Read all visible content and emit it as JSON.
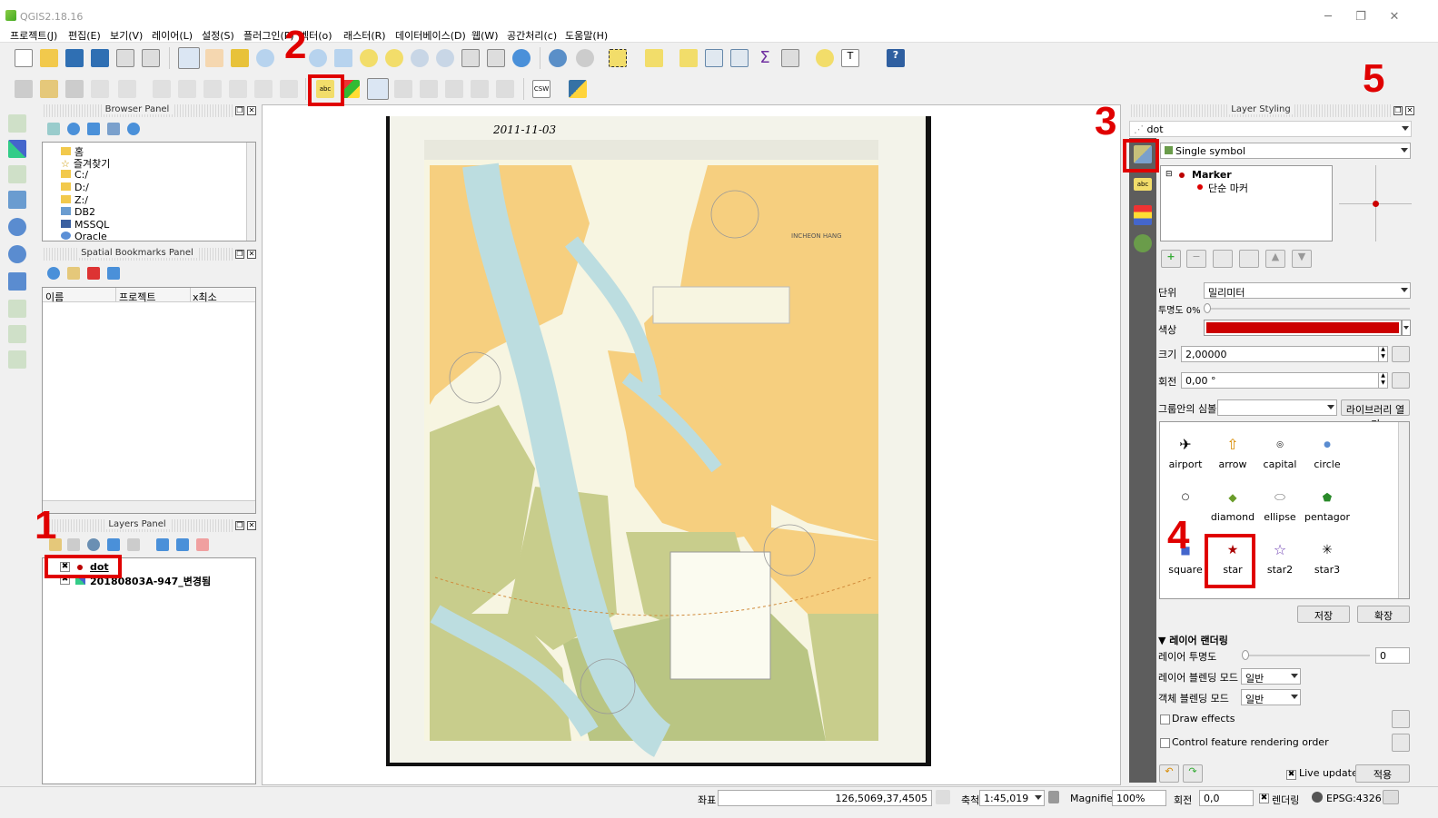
{
  "window": {
    "title": "QGIS2.18.16",
    "minimize": "─",
    "restore": "❐",
    "close": "✕"
  },
  "menu": [
    "프로젝트(J)",
    "편집(E)",
    "보기(V)",
    "레이어(L)",
    "설정(S)",
    "플러그인(P)",
    "벡터(o)",
    "래스터(R)",
    "데이터베이스(D)",
    "웹(W)",
    "공간처리(c)",
    "도움말(H)"
  ],
  "annotations": {
    "n1": "1",
    "n2": "2",
    "n3": "3",
    "n4": "4",
    "n5": "5"
  },
  "browser": {
    "title": "Browser Panel",
    "items": [
      "홈",
      "즐겨찾기",
      "C:/",
      "D:/",
      "Z:/",
      "DB2",
      "MSSQL",
      "Oracle"
    ]
  },
  "bookmarks": {
    "title": "Spatial Bookmarks Panel",
    "columns": [
      "이름",
      "프로젝트",
      "x최소"
    ]
  },
  "layers": {
    "title": "Layers Panel",
    "items": [
      "dot",
      "20180803A-947_변경됨"
    ]
  },
  "styling": {
    "title": "Layer Styling",
    "layer": "dot",
    "renderer": "Single symbol",
    "tree": {
      "marker": "Marker",
      "simple": "단순 마커"
    },
    "unit_label": "단위",
    "unit_value": "밀리미터",
    "opacity_label": "투명도 0%",
    "color_label": "색상",
    "color": "#cc0000",
    "size_label": "크기",
    "size_value": "2,00000",
    "rotation_label": "회전",
    "rotation_value": "0,00 °",
    "group_label": "그룹안의 심볼",
    "library_btn": "라이브러리 열기",
    "symbols": [
      {
        "name": "airport",
        "icon": "airplane-icon"
      },
      {
        "name": "arrow",
        "icon": "arrow-icon"
      },
      {
        "name": "capital",
        "icon": "capital-icon"
      },
      {
        "name": "circle",
        "icon": "circle-icon"
      },
      {
        "name": "",
        "icon": "circle-outline-icon"
      },
      {
        "name": "diamond",
        "icon": "diamond-icon"
      },
      {
        "name": "ellipse",
        "icon": "ellipse-icon"
      },
      {
        "name": "pentagor",
        "icon": "pentagon-icon"
      },
      {
        "name": "square",
        "icon": "square-icon"
      },
      {
        "name": "star",
        "icon": "star-icon"
      },
      {
        "name": "star2",
        "icon": "star2-icon"
      },
      {
        "name": "star3",
        "icon": "star3-icon"
      }
    ],
    "save_btn": "저장",
    "expand_btn": "확장",
    "layer_render_title": "레이어 랜더링",
    "layer_opacity_label": "레이어 투명도",
    "layer_opacity_value": "0",
    "layer_blend_label": "레이어 블렌딩 모드",
    "layer_blend_value": "일반",
    "feature_blend_label": "객체 블렌딩 모드",
    "feature_blend_value": "일반",
    "draw_effects": "Draw effects",
    "control_order": "Control feature rendering order",
    "live_update": "Live update",
    "apply_btn": "적용"
  },
  "map": {
    "handwritten": "2011-11-03",
    "chart_title": "INCHEON HANG"
  },
  "status": {
    "coord_label": "좌표",
    "coord_value": "126,5069,37,4505",
    "scale_label": "축척",
    "scale_value": "1:45,019",
    "magnifier_label": "Magnifier",
    "magnifier_value": "100%",
    "rotation_label": "회전",
    "rotation_value": "0,0",
    "render_label": "렌더링",
    "crs": "EPSG:4326"
  }
}
